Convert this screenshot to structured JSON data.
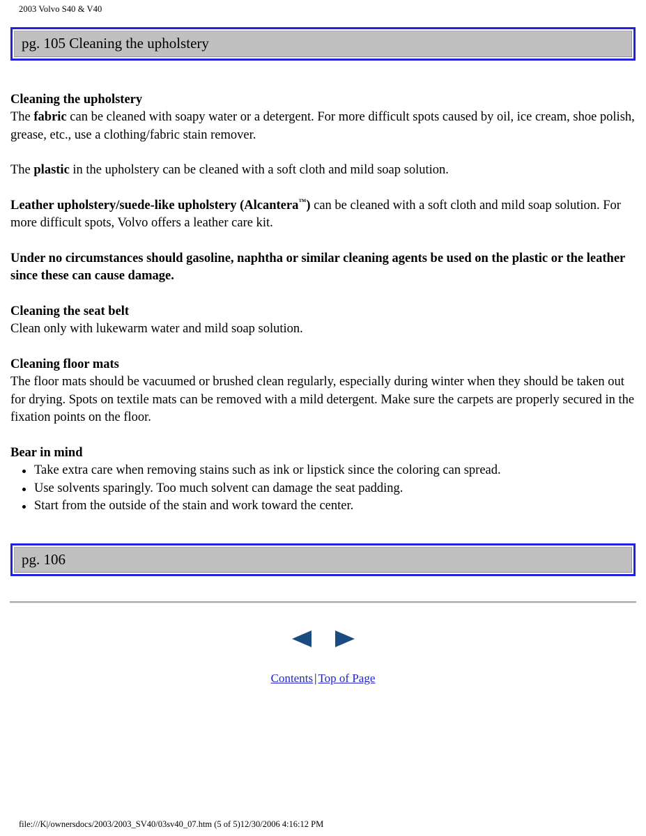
{
  "document": {
    "header": "2003 Volvo S40 & V40",
    "footer": "file:///K|/ownersdocs/2003/2003_SV40/03sv40_07.htm (5 of 5)12/30/2006 4:16:12 PM"
  },
  "banner_top": {
    "label": "pg. 105 Cleaning the upholstery"
  },
  "banner_bottom": {
    "label": "pg. 106"
  },
  "sections": {
    "upholstery": {
      "heading": "Cleaning the upholstery",
      "fabric_pre": "The ",
      "fabric_bold": "fabric",
      "fabric_post": " can be cleaned with soapy water or a detergent. For more difficult spots caused by oil, ice cream, shoe polish, grease, etc., use a clothing/fabric stain remover.",
      "plastic_pre": "The ",
      "plastic_bold": "plastic",
      "plastic_post": " in the upholstery can be cleaned with a soft cloth and mild soap solution.",
      "leather_bold": "Leather upholstery/suede-like upholstery (Alcantera",
      "leather_tm": "™",
      "leather_bold_close": ")",
      "leather_post": " can be cleaned with a soft cloth and mild soap solution. For more difficult spots, Volvo offers a leather care kit.",
      "warning": "Under no circumstances should gasoline, naphtha or similar cleaning agents be used on the plastic or the leather since these can cause damage."
    },
    "seat_belt": {
      "heading": "Cleaning the seat belt",
      "body": "Clean only with lukewarm water and mild soap solution."
    },
    "floor_mats": {
      "heading": "Cleaning floor mats",
      "body": "The floor mats should be vacuumed or brushed clean regularly, especially during winter when they should be taken out for drying. Spots on textile mats can be removed with a mild detergent. Make sure the carpets are properly secured in the fixation points on the floor."
    },
    "bear_in_mind": {
      "heading": "Bear in mind",
      "bullets": [
        "Take extra care when removing stains such as ink or lipstick since the coloring can spread.",
        "Use solvents sparingly. Too much solvent can damage the seat padding.",
        "Start from the outside of the stain and work toward the center."
      ]
    }
  },
  "navigation": {
    "previous_icon": "left-triangle-icon",
    "next_icon": "right-triangle-icon",
    "contents_link": "Contents",
    "separator": "|",
    "top_of_page_link": "Top of Page",
    "arrow_color": "#1a4c82"
  },
  "colors": {
    "banner_border": "#2222dd",
    "banner_fill": "#c0c0c0",
    "link": "#2222cc",
    "text": "#000000"
  }
}
